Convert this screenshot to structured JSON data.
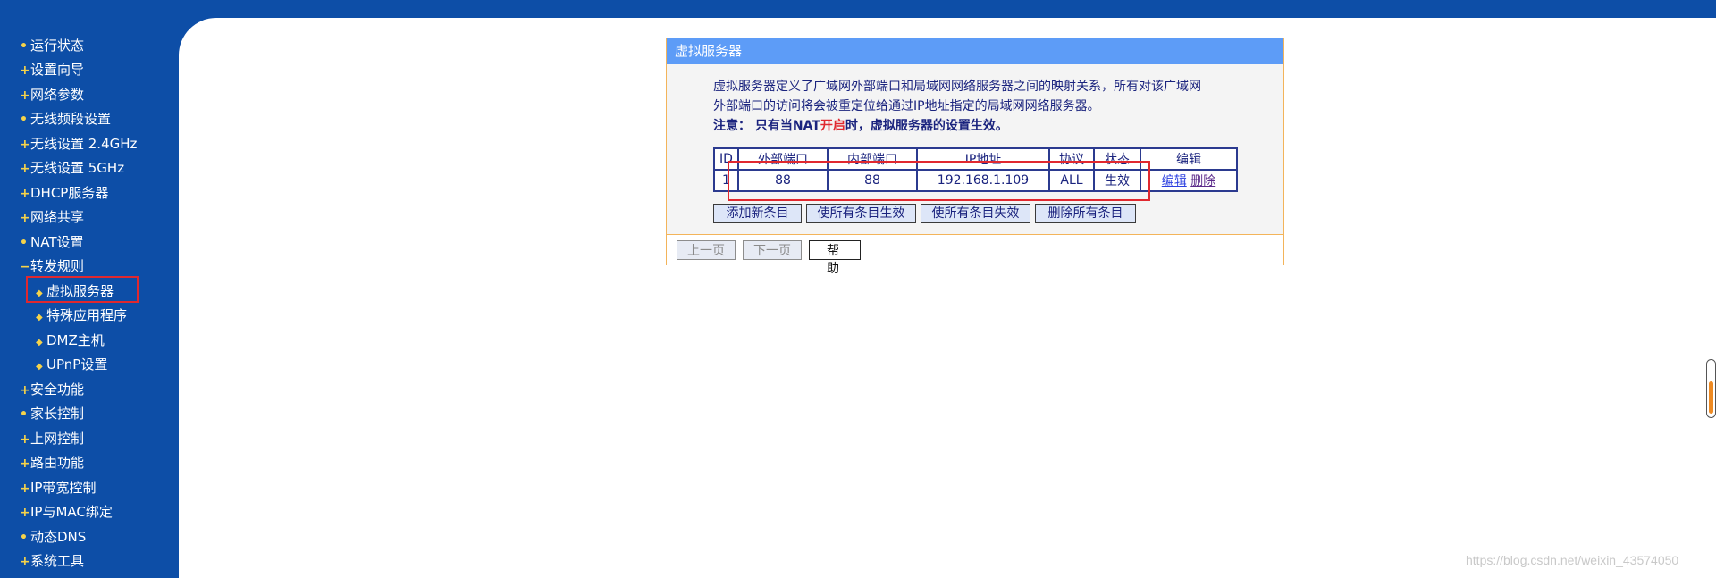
{
  "sidebar": {
    "items": [
      {
        "mark": "•",
        "label": "运行状态"
      },
      {
        "mark": "+",
        "label": "设置向导"
      },
      {
        "mark": "+",
        "label": "网络参数"
      },
      {
        "mark": "•",
        "label": "无线频段设置"
      },
      {
        "mark": "+",
        "label": "无线设置 2.4GHz"
      },
      {
        "mark": "+",
        "label": "无线设置 5GHz"
      },
      {
        "mark": "+",
        "label": "DHCP服务器"
      },
      {
        "mark": "+",
        "label": "网络共享"
      },
      {
        "mark": "•",
        "label": "NAT设置"
      },
      {
        "mark": "−",
        "label": "转发规则"
      },
      {
        "mark": "◆",
        "label": "虚拟服务器"
      },
      {
        "mark": "◆",
        "label": "特殊应用程序"
      },
      {
        "mark": "◆",
        "label": "DMZ主机"
      },
      {
        "mark": "◆",
        "label": "UPnP设置"
      },
      {
        "mark": "+",
        "label": "安全功能"
      },
      {
        "mark": "•",
        "label": "家长控制"
      },
      {
        "mark": "+",
        "label": "上网控制"
      },
      {
        "mark": "+",
        "label": "路由功能"
      },
      {
        "mark": "+",
        "label": "IP带宽控制"
      },
      {
        "mark": "+",
        "label": "IP与MAC绑定"
      },
      {
        "mark": "•",
        "label": "动态DNS"
      },
      {
        "mark": "+",
        "label": "系统工具"
      }
    ]
  },
  "panel": {
    "title": "虚拟服务器",
    "desc_line1": "虚拟服务器定义了广域网外部端口和局域网网络服务器之间的映射关系，所有对该广域网",
    "desc_line2": "外部端口的访问将会被重定位给通过IP地址指定的局域网网络服务器。",
    "note_prefix": "注意：  只有当NAT",
    "note_highlight": "开启",
    "note_suffix": "时，虚拟服务器的设置生效。",
    "table": {
      "headers": [
        "ID",
        "外部端口",
        "内部端口",
        "IP地址",
        "协议",
        "状态",
        "编辑"
      ],
      "rows": [
        {
          "id": "1",
          "ext": "88",
          "int": "88",
          "ip": "192.168.1.109",
          "proto": "ALL",
          "state": "生效",
          "edit": "编辑",
          "delete": "删除"
        }
      ]
    },
    "buttons": {
      "add": "添加新条目",
      "enable_all": "使所有条目生效",
      "disable_all": "使所有条目失效",
      "delete_all": "删除所有条目"
    },
    "footer": {
      "prev": "上一页",
      "next": "下一页",
      "help": "帮 助"
    }
  },
  "watermark": "https://blog.csdn.net/weixin_43574050",
  "colors": {
    "sidebar_bg": "#0d4ea7",
    "panel_header": "#5d9cf7",
    "highlight_red": "#e0282f",
    "accent_yellow": "#f5d34a"
  }
}
